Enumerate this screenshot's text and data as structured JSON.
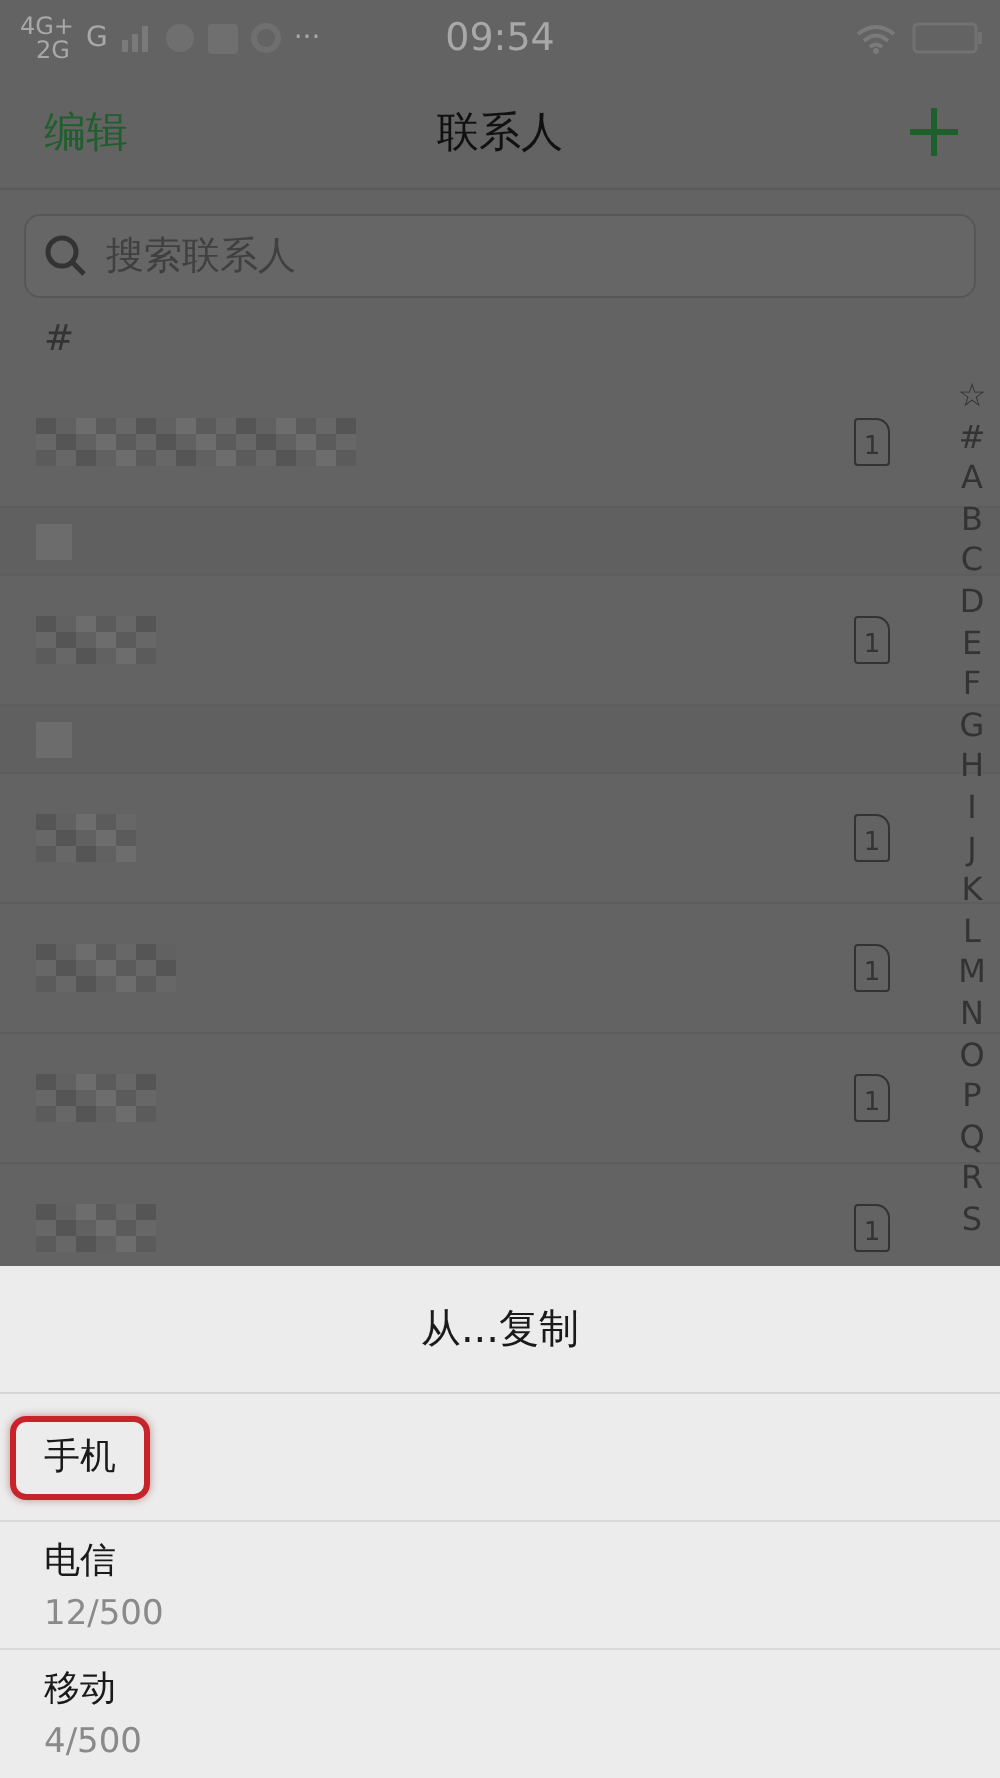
{
  "status_bar": {
    "network_top": "4G+",
    "network_bottom": "2G",
    "network_second": "G",
    "more": "···",
    "time": "09:54"
  },
  "header": {
    "left_action": "编辑",
    "title": "联系人"
  },
  "search": {
    "placeholder": "搜索联系人"
  },
  "section_header": "#",
  "contacts": [
    {
      "kind": "contact",
      "sim": "1"
    },
    {
      "kind": "section"
    },
    {
      "kind": "contact",
      "sim": "1"
    },
    {
      "kind": "section"
    },
    {
      "kind": "contact",
      "sim": "1"
    },
    {
      "kind": "contact",
      "sim": "1"
    },
    {
      "kind": "contact",
      "sim": "1"
    },
    {
      "kind": "contact",
      "sim": "1"
    }
  ],
  "index": [
    "☆",
    "#",
    "A",
    "B",
    "C",
    "D",
    "E",
    "F",
    "G",
    "H",
    "I",
    "J",
    "K",
    "L",
    "M",
    "N",
    "O",
    "P",
    "Q",
    "R",
    "S"
  ],
  "sheet": {
    "title": "从...复制",
    "options": [
      {
        "label": "手机",
        "highlighted": true
      },
      {
        "label": "电信",
        "detail": "12/500",
        "highlighted": false
      },
      {
        "label": "移动",
        "detail": "4/500",
        "highlighted": false
      }
    ]
  }
}
